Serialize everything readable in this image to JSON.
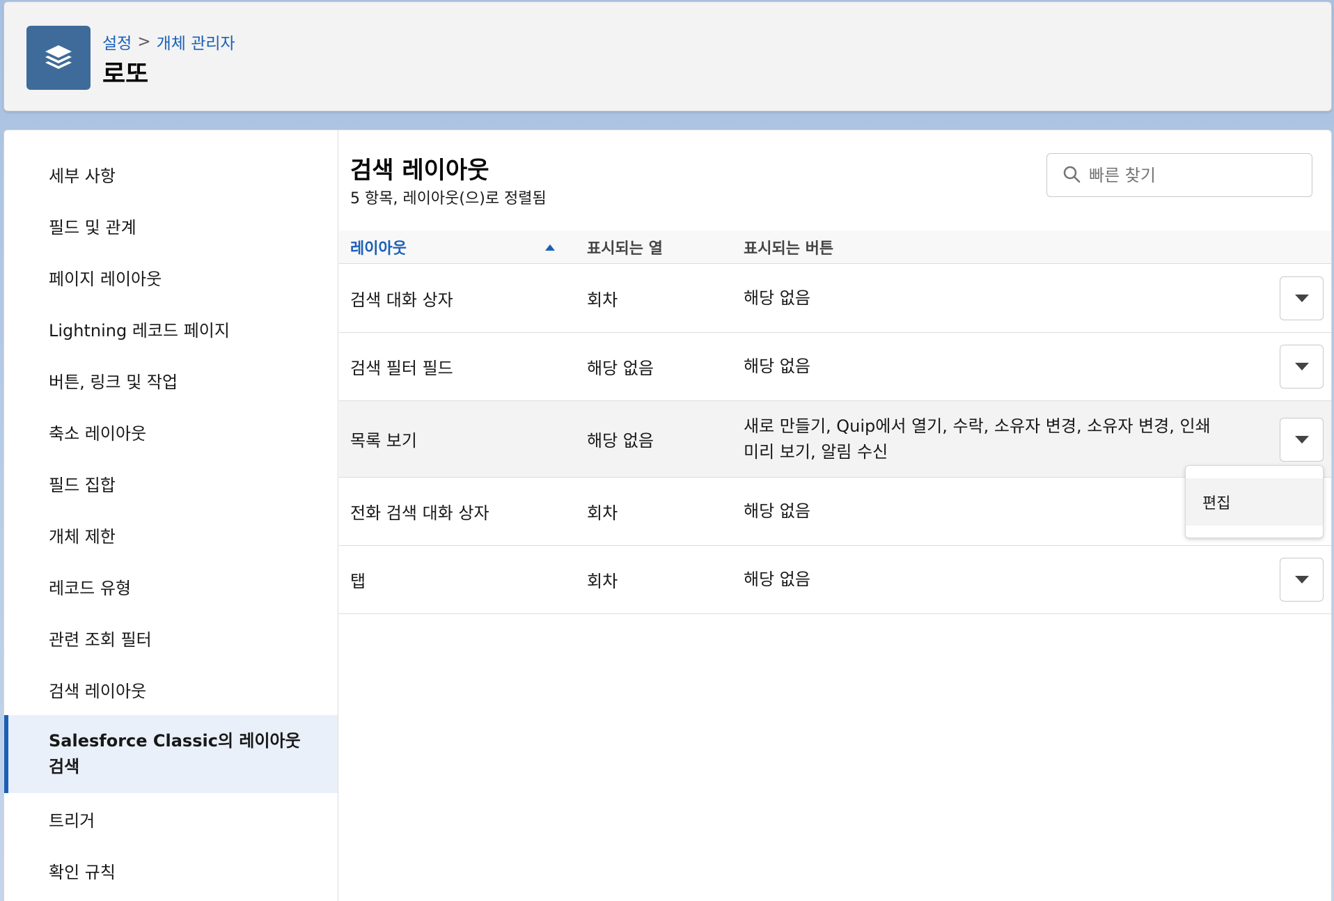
{
  "header": {
    "breadcrumb": {
      "root": "설정",
      "separator": ">",
      "current": "개체 관리자"
    },
    "title": "로또",
    "icon": "layers-icon"
  },
  "sidebar": {
    "items": [
      {
        "label": "세부 사항"
      },
      {
        "label": "필드 및 관계"
      },
      {
        "label": "페이지 레이아웃"
      },
      {
        "label": "Lightning 레코드 페이지"
      },
      {
        "label": "버튼, 링크 및 작업"
      },
      {
        "label": "축소 레이아웃"
      },
      {
        "label": "필드 집합"
      },
      {
        "label": "개체 제한"
      },
      {
        "label": "레코드 유형"
      },
      {
        "label": "관련 조회 필터"
      },
      {
        "label": "검색 레이아웃"
      },
      {
        "label": "Salesforce Classic의 레이아웃 검색",
        "active": true
      },
      {
        "label": "트리거"
      },
      {
        "label": "확인 규칙"
      }
    ]
  },
  "main": {
    "title": "검색 레이아웃",
    "subtitle": "5 항목, 레이아웃(으)로 정렬됨",
    "search": {
      "placeholder": "빠른 찾기",
      "value": ""
    },
    "columns": [
      "레이아웃",
      "표시되는 열",
      "표시되는 버튼"
    ],
    "rows": [
      {
        "layout": "검색 대화 상자",
        "columns": "회차",
        "buttons": "해당 없음"
      },
      {
        "layout": "검색 필터 필드",
        "columns": "해당 없음",
        "buttons": "해당 없음"
      },
      {
        "layout": "목록 보기",
        "columns": "해당 없음",
        "buttons": "새로 만들기, Quip에서 열기, 수락, 소유자 변경, 소유자 변경, 인쇄 미리 보기, 알림 수신"
      },
      {
        "layout": "전화 검색 대화 상자",
        "columns": "회차",
        "buttons": "해당 없음"
      },
      {
        "layout": "탭",
        "columns": "회차",
        "buttons": "해당 없음"
      }
    ],
    "row_menu": {
      "items": [
        "편집"
      ]
    }
  },
  "colors": {
    "accent": "#1b5fb8",
    "header_icon_bg": "#3e6b99",
    "active_nav_bg": "#e9f0fa",
    "highlight_row_bg": "#f3f3f3"
  }
}
